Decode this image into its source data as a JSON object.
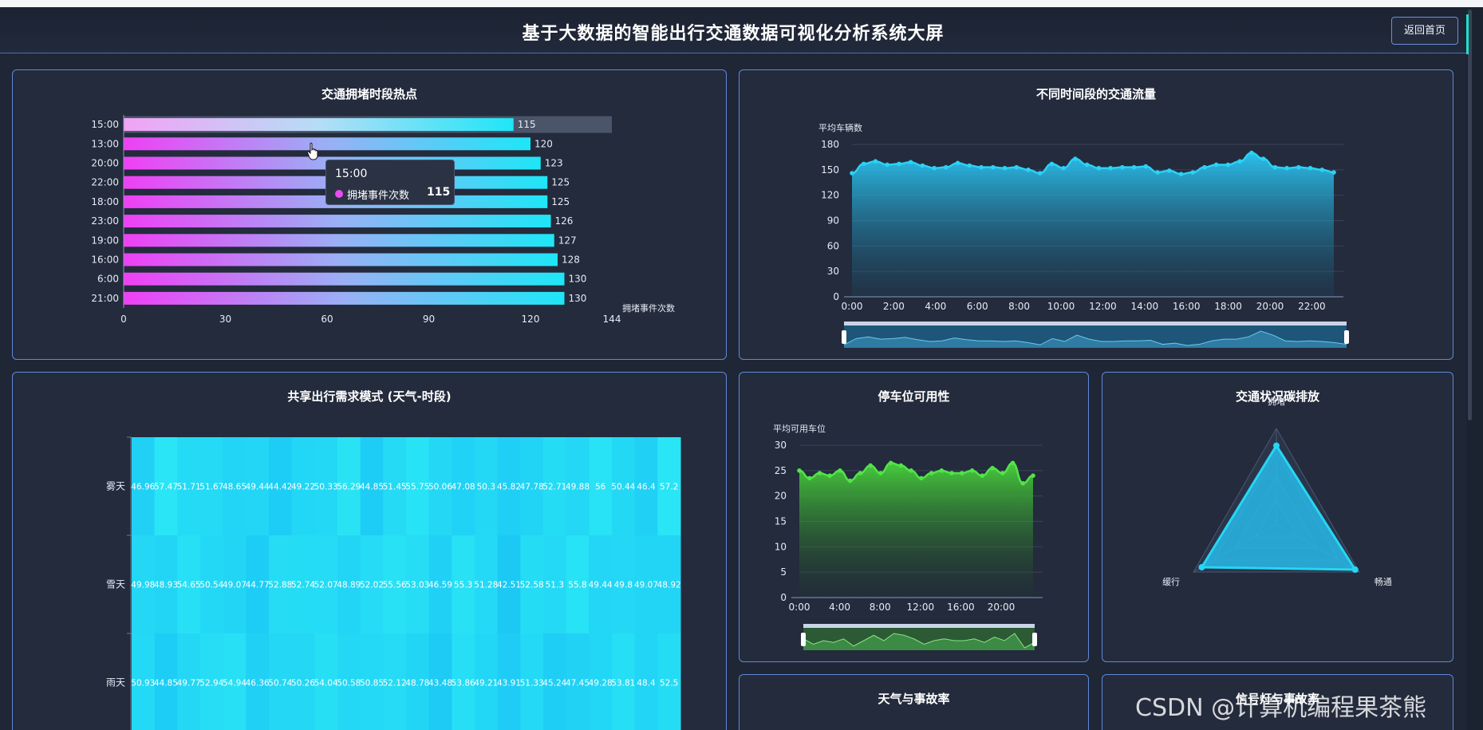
{
  "header": {
    "title": "基于大数据的智能出行交通数据可视化分析系统大屏",
    "back_label": "返回首页"
  },
  "colors": {
    "panel_border": "#5f88d8",
    "bar_start": "#f03ff5",
    "bar_end": "#1ee6f7",
    "area_blue": "#29b7e8",
    "area_green": "#4ad13b",
    "heat": "#1ee6f7"
  },
  "panels": {
    "congestion_title": "交通拥堵时段热点",
    "flow_title": "不同时间段的交通流量",
    "sharing_title": "共享出行需求模式 (天气-时段)",
    "parking_title": "停车位可用性",
    "emission_title": "交通状况碳排放",
    "weather_title": "天气与事故率",
    "signal_title": "信号灯与事故率"
  },
  "tooltip": {
    "header": "15:00",
    "label": "拥堵事件次数",
    "value": "115"
  },
  "watermark": "CSDN @计算机编程果茶熊",
  "chart_data": [
    {
      "id": "congestion",
      "type": "bar",
      "orientation": "horizontal",
      "categories": [
        "15:00",
        "13:00",
        "20:00",
        "22:00",
        "18:00",
        "23:00",
        "19:00",
        "16:00",
        "6:00",
        "21:00"
      ],
      "values": [
        115,
        120,
        123,
        125,
        125,
        126,
        127,
        128,
        130,
        130
      ],
      "xlabel": "拥堵事件次数",
      "xticks": [
        0,
        30,
        60,
        90,
        120,
        144
      ],
      "xlim": [
        0,
        144
      ],
      "highlighted": "15:00"
    },
    {
      "id": "flow",
      "type": "area",
      "x": [
        "0:00",
        "2:00",
        "4:00",
        "6:00",
        "8:00",
        "10:00",
        "12:00",
        "14:00",
        "16:00",
        "18:00",
        "20:00",
        "22:00"
      ],
      "values": [
        146,
        157,
        160,
        156,
        157,
        159,
        155,
        152,
        153,
        158,
        155,
        153,
        153,
        152,
        153,
        150,
        146,
        157,
        152,
        163,
        156,
        152,
        152,
        153,
        153,
        154,
        147,
        149,
        145,
        147,
        153,
        156,
        156,
        160,
        170,
        163,
        153,
        152,
        153,
        152,
        150,
        147
      ],
      "ylabel": "平均车辆数",
      "yticks": [
        0,
        30,
        60,
        90,
        120,
        150,
        180
      ],
      "ylim": [
        0,
        180
      ]
    },
    {
      "id": "parking",
      "type": "area",
      "x": [
        "0:00",
        "4:00",
        "8:00",
        "12:00",
        "16:00",
        "20:00"
      ],
      "values": [
        25,
        23.5,
        24.5,
        24,
        25,
        23,
        24.5,
        26,
        24.5,
        26.5,
        26,
        25,
        23.5,
        24.5,
        25,
        24.5,
        24.5,
        25,
        24,
        25.5,
        24.5,
        26.5,
        22.5,
        24
      ],
      "ylabel": "平均可用车位",
      "yticks": [
        0,
        5,
        10,
        15,
        20,
        25,
        30
      ],
      "ylim": [
        0,
        30
      ]
    },
    {
      "id": "emission",
      "type": "radar",
      "indicators": [
        "拥堵",
        "畅通",
        "缓行"
      ],
      "values": [
        0.82,
        0.95,
        0.9
      ]
    },
    {
      "id": "sharing",
      "type": "heatmap",
      "rows": [
        {
          "name": "雾天",
          "values": [
            "46.96",
            "57.47",
            "51.71",
            "51.67",
            "48.65",
            "49.44",
            "44.42",
            "49.22",
            "50.33",
            "56.29",
            "44.85",
            "51.45",
            "55.75",
            "50.06",
            "47.08",
            "50.3",
            "45.82",
            "47.78",
            "52.71",
            "49.88",
            "56",
            "50.44",
            "46.4",
            "57.2"
          ]
        },
        {
          "name": "雪天",
          "values": [
            "49.98",
            "48.93",
            "54.65",
            "50.54",
            "49.07",
            "44.77",
            "52.88",
            "52.74",
            "52.07",
            "48.89",
            "52.02",
            "55.56",
            "53.03",
            "46.59",
            "55.3",
            "51.28",
            "42.51",
            "52.58",
            "51.3",
            "55.8",
            "49.44",
            "49.8",
            "49.07",
            "48.92"
          ]
        },
        {
          "name": "雨天",
          "values": [
            "50.93",
            "44.85",
            "49.77",
            "52.94",
            "54.94",
            "46.36",
            "50.74",
            "50.26",
            "54.04",
            "50.58",
            "50.85",
            "52.12",
            "48.78",
            "43.48",
            "53.86",
            "49.21",
            "43.91",
            "51.33",
            "45.24",
            "47.45",
            "49.28",
            "53.81",
            "48.4",
            "52.5"
          ]
        }
      ]
    }
  ]
}
